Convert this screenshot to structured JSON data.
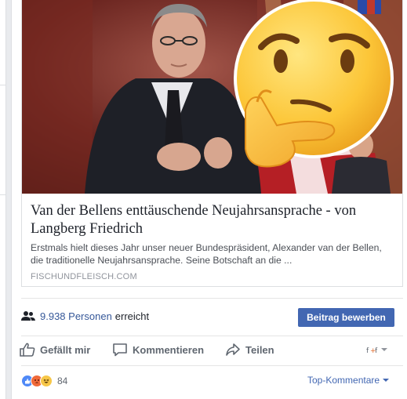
{
  "post": {
    "link_title": "Van der Bellens enttäuschende Neujahrsansprache - von Langberg Friedrich",
    "link_description": "Erstmals hielt dieses Jahr unser neuer Bundespräsident, Alexander van der Bellen, die traditionelle Neujahrsansprache. Seine Botschaft an die ...",
    "link_domain": "FISCHUNDFLEISCH.COM",
    "image_alt": "Photo of man in suit with thinking-face emoji",
    "reach_count": "9.938 Personen",
    "reach_suffix": "erreicht",
    "boost_label": "Beitrag bewerben"
  },
  "actions": {
    "like": "Gefällt mir",
    "comment": "Kommentieren",
    "share": "Teilen"
  },
  "reactions": {
    "count": "84",
    "sort_label": "Top-Kommentare"
  },
  "colors": {
    "accent": "#4267b2",
    "link": "#365899",
    "muted": "#606770"
  }
}
